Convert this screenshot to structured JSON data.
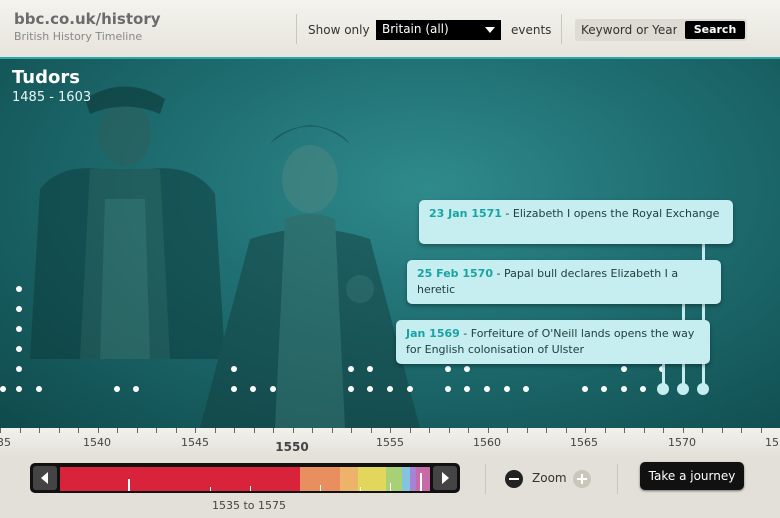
{
  "header": {
    "site_title": "bbc.co.uk/history",
    "subtitle": "British History Timeline",
    "show_only_label": "Show only",
    "filter_value": "Britain (all)",
    "events_label": "events",
    "search_placeholder": "Keyword or Year",
    "search_button": "Search"
  },
  "period": {
    "title": "Tudors",
    "range": "1485 - 1603"
  },
  "events": [
    {
      "date": "23 Jan 1571",
      "text": " - Elizabeth I opens the Royal Exchange"
    },
    {
      "date": "25 Feb 1570",
      "text": " - Papal bull declares Elizabeth I a heretic"
    },
    {
      "date": "Jan 1569",
      "text": " - Forfeiture of O'Neill lands opens the way for English colonisation of Ulster"
    }
  ],
  "ruler": {
    "labels": [
      "35",
      "1540",
      "1545",
      "1550",
      "1555",
      "1560",
      "1565",
      "1570",
      "15"
    ],
    "major": "1550"
  },
  "footer": {
    "zoom_label": "Zoom",
    "journey_button": "Take a journey",
    "range_label": "1535 to 1575"
  },
  "colors": {
    "teal_accent": "#2aa8a8",
    "bubble": "#c6eef0",
    "date_text": "#1aa3a3",
    "strip_red": "#d8233a",
    "strip_orange": "#e0682a",
    "strip_yellow": "#d9c827",
    "strip_green": "#8bc24a"
  },
  "icons": [
    "chevron-down-icon",
    "arrow-left-icon",
    "arrow-right-icon",
    "minus-icon",
    "plus-icon"
  ]
}
